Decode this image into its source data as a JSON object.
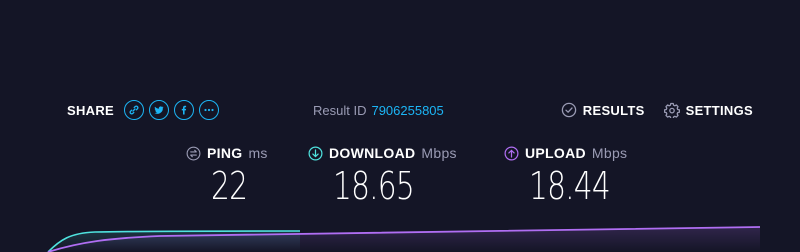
{
  "share": {
    "label": "SHARE",
    "icons": [
      "link-icon",
      "twitter-icon",
      "facebook-icon",
      "more-icon"
    ]
  },
  "result": {
    "label": "Result ID",
    "id": "7906255805"
  },
  "links": {
    "results_label": "RESULTS",
    "settings_label": "SETTINGS"
  },
  "metrics": {
    "ping": {
      "label": "PING",
      "unit": "ms",
      "value": "22"
    },
    "download": {
      "label": "DOWNLOAD",
      "unit": "Mbps",
      "value": "18.65"
    },
    "upload": {
      "label": "UPLOAD",
      "unit": "Mbps",
      "value": "18.44"
    }
  },
  "colors": {
    "background": "#141526",
    "accent": "#1cb5f5",
    "download": "#4fe3df",
    "upload": "#b06ef3",
    "muted": "#9a9bb4"
  }
}
